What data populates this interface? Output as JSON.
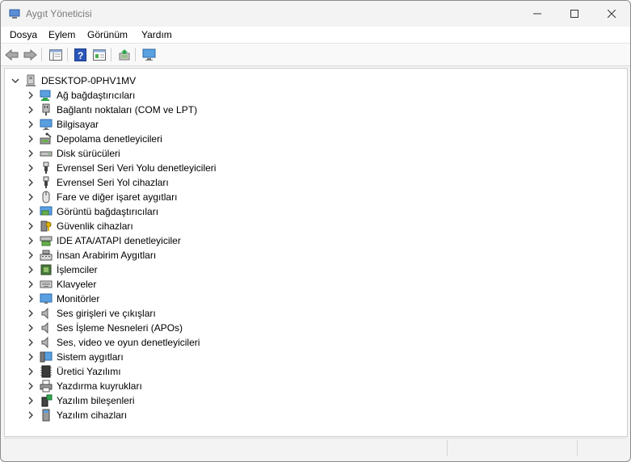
{
  "window": {
    "title": "Aygıt Yöneticisi"
  },
  "menu": [
    {
      "label": "Dosya"
    },
    {
      "label": "Eylem"
    },
    {
      "label": "Görünüm"
    },
    {
      "label": "Yardım"
    }
  ],
  "toolbar": [
    {
      "icon": "back-arrow-icon"
    },
    {
      "icon": "forward-arrow-icon"
    },
    {
      "icon": "show-hide-console-tree-icon"
    },
    {
      "icon": "help-icon"
    },
    {
      "icon": "properties-view-icon"
    },
    {
      "icon": "update-driver-icon"
    },
    {
      "icon": "scan-hardware-changes-icon"
    }
  ],
  "tree": {
    "root": "DESKTOP-0PHV1MV",
    "items": [
      {
        "label": "Ağ bağdaştırıcıları",
        "icon": "network-adapter-icon"
      },
      {
        "label": "Bağlantı noktaları (COM ve LPT)",
        "icon": "port-icon"
      },
      {
        "label": "Bilgisayar",
        "icon": "computer-icon"
      },
      {
        "label": "Depolama denetleyicileri",
        "icon": "storage-controller-icon"
      },
      {
        "label": "Disk sürücüleri",
        "icon": "disk-drive-icon"
      },
      {
        "label": "Evrensel Seri Veri Yolu denetleyicileri",
        "icon": "usb-icon"
      },
      {
        "label": "Evrensel Seri Yol cihazları",
        "icon": "usb-icon"
      },
      {
        "label": "Fare ve diğer işaret aygıtları",
        "icon": "mouse-icon"
      },
      {
        "label": "Görüntü bağdaştırıcıları",
        "icon": "display-adapter-icon"
      },
      {
        "label": "Güvenlik cihazları",
        "icon": "security-device-icon"
      },
      {
        "label": "IDE ATA/ATAPI denetleyiciler",
        "icon": "ide-controller-icon"
      },
      {
        "label": "İnsan Arabirim Aygıtları",
        "icon": "hid-icon"
      },
      {
        "label": "İşlemciler",
        "icon": "processor-icon"
      },
      {
        "label": "Klavyeler",
        "icon": "keyboard-icon"
      },
      {
        "label": "Monitörler",
        "icon": "monitor-icon"
      },
      {
        "label": "Ses girişleri ve çıkışları",
        "icon": "speaker-icon"
      },
      {
        "label": "Ses İşleme Nesneleri (APOs)",
        "icon": "speaker-icon"
      },
      {
        "label": "Ses, video ve oyun denetleyicileri",
        "icon": "speaker-icon"
      },
      {
        "label": "Sistem aygıtları",
        "icon": "system-device-icon"
      },
      {
        "label": "Üretici Yazılımı",
        "icon": "firmware-icon"
      },
      {
        "label": "Yazdırma kuyrukları",
        "icon": "printer-icon"
      },
      {
        "label": "Yazılım bileşenleri",
        "icon": "software-component-icon"
      },
      {
        "label": "Yazılım cihazları",
        "icon": "software-device-icon"
      }
    ]
  },
  "colors": {
    "titlebar": "#f3f3f3",
    "accent": "#0078d4",
    "text": "#000000"
  }
}
